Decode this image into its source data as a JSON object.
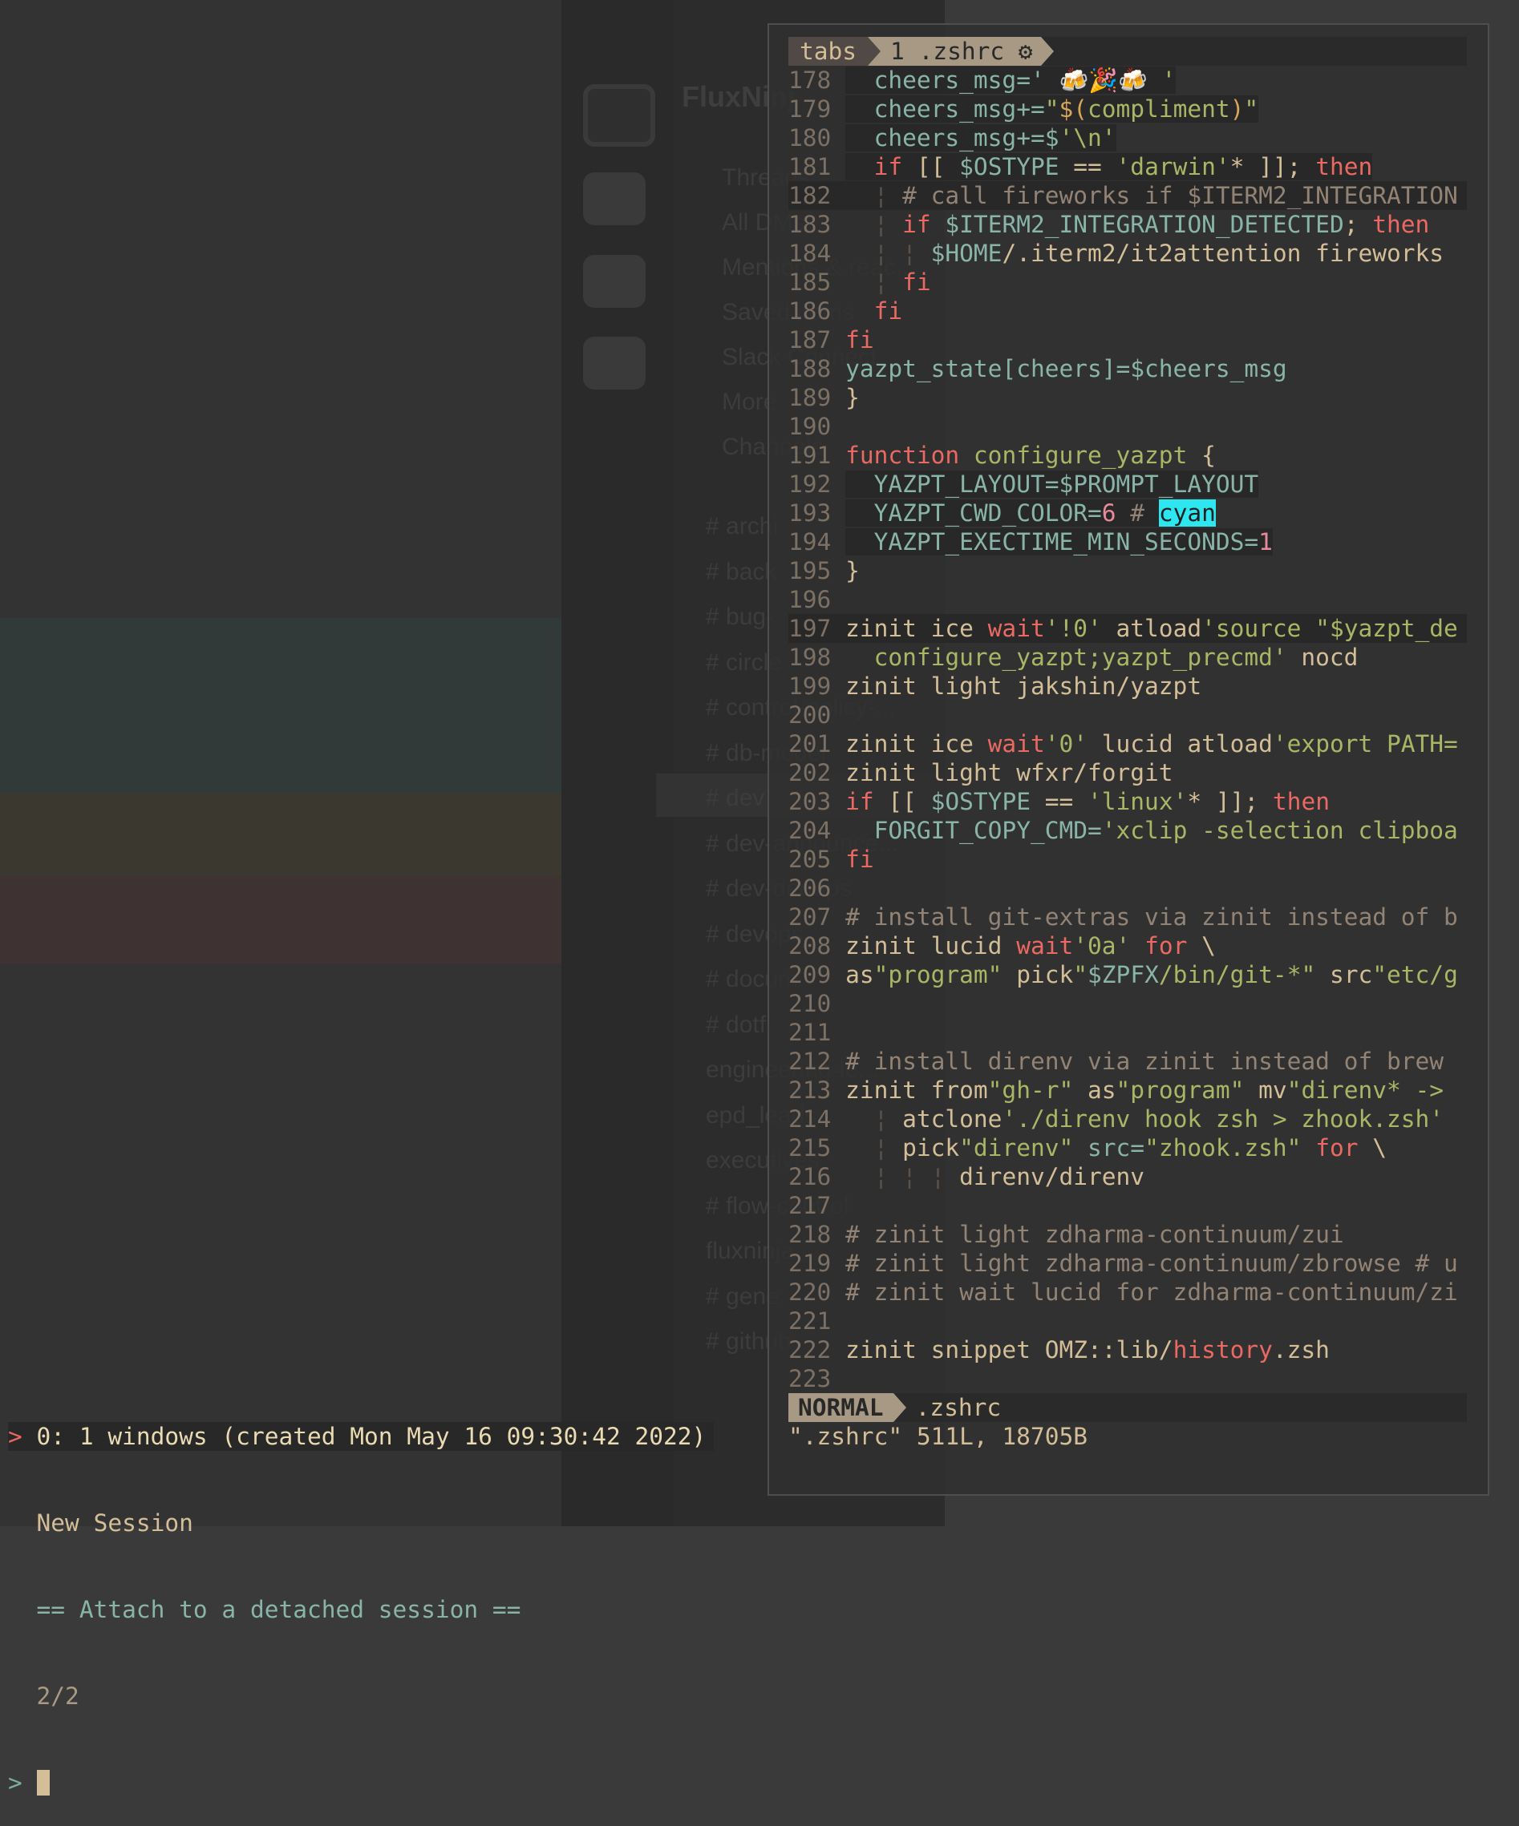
{
  "background": {
    "slack": {
      "workspace": "FluxNinj",
      "nav": [
        "Threads",
        "All DMs",
        "Mentions & reac...",
        "Saved items",
        "Slack Connect",
        "More",
        "Channels"
      ],
      "channels": [
        "# archi",
        "# back",
        "# bug-",
        "# circle",
        "# control-policy-...",
        "# db-model",
        "# dev",
        "# dev-announce...",
        "# dev-dedups",
        "# devops",
        "# docum",
        "# dotfi",
        "engineering-le...",
        "epd_leads",
        "executives",
        "# flow-control",
        "fluxninja",
        "# gene",
        "# github"
      ]
    }
  },
  "editor": {
    "tabline": {
      "tabs_label": "tabs",
      "active_tab": "1 .zshrc ⚙"
    },
    "lines": [
      {
        "n": "178",
        "hl": true,
        "seg": [
          [
            "  cheers_msg='",
            "v"
          ],
          [
            " 🍻🎉🍻 ",
            "t"
          ],
          [
            "'",
            "s"
          ]
        ]
      },
      {
        "n": "179",
        "hl": true,
        "seg": [
          [
            "  cheers_msg+=",
            "v"
          ],
          [
            "\"",
            "s"
          ],
          [
            "$(",
            "o"
          ],
          [
            "compliment",
            "s"
          ],
          [
            ")",
            "o"
          ],
          [
            "\"",
            "s"
          ]
        ]
      },
      {
        "n": "180",
        "hl": true,
        "seg": [
          [
            "  cheers_msg+=$",
            "v"
          ],
          [
            "'\\n'",
            "s"
          ]
        ]
      },
      {
        "n": "181",
        "hl": true,
        "seg": [
          [
            "  ",
            "t"
          ],
          [
            "if",
            "k"
          ],
          [
            " [[ ",
            "t"
          ],
          [
            "$OSTYPE",
            "v"
          ],
          [
            " == ",
            "t"
          ],
          [
            "'darwin'",
            "s"
          ],
          [
            "* ]]; ",
            "t"
          ],
          [
            "then",
            "k"
          ]
        ]
      },
      {
        "n": "182",
        "hl": true,
        "seg": [
          [
            "  ¦ ",
            "g"
          ],
          [
            "# call fireworks if $ITERM2_INTEGRATION",
            "c"
          ]
        ]
      },
      {
        "n": "183",
        "seg": [
          [
            "  ¦ ",
            "g"
          ],
          [
            "if",
            "k"
          ],
          [
            " ",
            "t"
          ],
          [
            "$ITERM2_INTEGRATION_DETECTED",
            "v"
          ],
          [
            "; ",
            "t"
          ],
          [
            "then",
            "k"
          ]
        ]
      },
      {
        "n": "184",
        "seg": [
          [
            "  ¦ ¦ ",
            "g"
          ],
          [
            "$HOME",
            "v"
          ],
          [
            "/.iterm2/it2attention fireworks",
            "t"
          ]
        ]
      },
      {
        "n": "185",
        "seg": [
          [
            "  ¦ ",
            "g"
          ],
          [
            "fi",
            "k"
          ]
        ]
      },
      {
        "n": "186",
        "seg": [
          [
            "  ",
            "t"
          ],
          [
            "fi",
            "k"
          ]
        ]
      },
      {
        "n": "187",
        "seg": [
          [
            "fi",
            "k"
          ]
        ]
      },
      {
        "n": "188",
        "seg": [
          [
            "yazpt_state[cheers]=$cheers_msg",
            "v"
          ]
        ]
      },
      {
        "n": "189",
        "seg": [
          [
            "}",
            "t"
          ]
        ]
      },
      {
        "n": "190",
        "seg": []
      },
      {
        "n": "191",
        "seg": [
          [
            "function",
            "k"
          ],
          [
            " ",
            "t"
          ],
          [
            "configure_yazpt",
            "s"
          ],
          [
            " {",
            "t"
          ]
        ]
      },
      {
        "n": "192",
        "hl": true,
        "seg": [
          [
            "  YAZPT_LAYOUT=$PROMPT_LAYOUT",
            "v"
          ]
        ]
      },
      {
        "n": "193",
        "hl": true,
        "seg": [
          [
            "  YAZPT_CWD_COLOR=",
            "v"
          ],
          [
            "6",
            "n"
          ],
          [
            " # ",
            "c"
          ],
          [
            "cyan",
            "cy"
          ]
        ]
      },
      {
        "n": "194",
        "hl": true,
        "seg": [
          [
            "  YAZPT_EXECTIME_MIN_SECONDS=",
            "v"
          ],
          [
            "1",
            "n"
          ]
        ]
      },
      {
        "n": "195",
        "seg": [
          [
            "}",
            "t"
          ]
        ]
      },
      {
        "n": "196",
        "seg": []
      },
      {
        "n": "197",
        "hl": true,
        "seg": [
          [
            "zinit ice ",
            "t"
          ],
          [
            "wait",
            "k"
          ],
          [
            "'!0'",
            "s"
          ],
          [
            " atload",
            "t"
          ],
          [
            "'source \"$yazpt_de",
            "s"
          ]
        ]
      },
      {
        "n": "198",
        "seg": [
          [
            "  configure_yazpt;yazpt_precmd'",
            "s"
          ],
          [
            " nocd",
            "t"
          ]
        ]
      },
      {
        "n": "199",
        "seg": [
          [
            "zinit light jakshin/yazpt",
            "t"
          ]
        ]
      },
      {
        "n": "200",
        "seg": []
      },
      {
        "n": "201",
        "seg": [
          [
            "zinit ice ",
            "t"
          ],
          [
            "wait",
            "k"
          ],
          [
            "'0'",
            "s"
          ],
          [
            " lucid atload",
            "t"
          ],
          [
            "'export PATH=",
            "s"
          ]
        ]
      },
      {
        "n": "202",
        "seg": [
          [
            "zinit light wfxr/forgit",
            "t"
          ]
        ]
      },
      {
        "n": "203",
        "seg": [
          [
            "if",
            "k"
          ],
          [
            " [[ ",
            "t"
          ],
          [
            "$OSTYPE",
            "v"
          ],
          [
            " == ",
            "t"
          ],
          [
            "'linux'",
            "s"
          ],
          [
            "* ]]; ",
            "t"
          ],
          [
            "then",
            "k"
          ]
        ]
      },
      {
        "n": "204",
        "seg": [
          [
            "  FORGIT_COPY_CMD=",
            "v"
          ],
          [
            "'xclip -selection clipboa",
            "s"
          ]
        ]
      },
      {
        "n": "205",
        "seg": [
          [
            "fi",
            "k"
          ]
        ]
      },
      {
        "n": "206",
        "seg": []
      },
      {
        "n": "207",
        "seg": [
          [
            "# install git-extras via zinit instead of b",
            "c"
          ]
        ]
      },
      {
        "n": "208",
        "seg": [
          [
            "zinit lucid ",
            "t"
          ],
          [
            "wait",
            "k"
          ],
          [
            "'0a'",
            "s"
          ],
          [
            " ",
            "t"
          ],
          [
            "for",
            "k"
          ],
          [
            " \\",
            "t"
          ]
        ]
      },
      {
        "n": "209",
        "seg": [
          [
            "as",
            "t"
          ],
          [
            "\"program\"",
            "s"
          ],
          [
            " pick",
            "t"
          ],
          [
            "\"",
            "s"
          ],
          [
            "$ZPFX",
            "v"
          ],
          [
            "/bin/git-*",
            "s"
          ],
          [
            "\"",
            "s"
          ],
          [
            " src",
            "t"
          ],
          [
            "\"etc/g",
            "s"
          ]
        ]
      },
      {
        "n": "210",
        "seg": []
      },
      {
        "n": "211",
        "seg": []
      },
      {
        "n": "212",
        "seg": [
          [
            "# install direnv via zinit instead of brew",
            "c"
          ]
        ]
      },
      {
        "n": "213",
        "seg": [
          [
            "zinit from",
            "t"
          ],
          [
            "\"gh-r\"",
            "s"
          ],
          [
            " as",
            "t"
          ],
          [
            "\"program\"",
            "s"
          ],
          [
            " mv",
            "t"
          ],
          [
            "\"direnv* ->",
            "s"
          ]
        ]
      },
      {
        "n": "214",
        "seg": [
          [
            "  ¦ ",
            "g"
          ],
          [
            "atclone",
            "t"
          ],
          [
            "'./direnv hook zsh > zhook.zsh'",
            "s"
          ]
        ]
      },
      {
        "n": "215",
        "seg": [
          [
            "  ¦ ",
            "g"
          ],
          [
            "pick",
            "t"
          ],
          [
            "\"direnv\"",
            "s"
          ],
          [
            " ",
            "t"
          ],
          [
            "src=",
            "v"
          ],
          [
            "\"zhook.zsh\"",
            "s"
          ],
          [
            " ",
            "t"
          ],
          [
            "for",
            "k"
          ],
          [
            " \\",
            "t"
          ]
        ]
      },
      {
        "n": "216",
        "seg": [
          [
            "  ¦ ¦ ¦ ",
            "g"
          ],
          [
            "direnv/direnv",
            "t"
          ]
        ]
      },
      {
        "n": "217",
        "seg": []
      },
      {
        "n": "218",
        "seg": [
          [
            "# zinit light zdharma-continuum/zui",
            "c"
          ]
        ]
      },
      {
        "n": "219",
        "seg": [
          [
            "# zinit light zdharma-continuum/zbrowse # u",
            "c"
          ]
        ]
      },
      {
        "n": "220",
        "seg": [
          [
            "# zinit wait lucid for zdharma-continuum/zi",
            "c"
          ]
        ]
      },
      {
        "n": "221",
        "seg": []
      },
      {
        "n": "222",
        "seg": [
          [
            "zinit snippet OMZ::lib/",
            "t"
          ],
          [
            "history",
            "k"
          ],
          [
            ".zsh",
            "t"
          ]
        ]
      },
      {
        "n": "223",
        "seg": []
      }
    ],
    "statusline": {
      "mode": "NORMAL",
      "filename": ".zshrc"
    },
    "message": "\".zshrc\" 511L, 18705B"
  },
  "tmux_chooser": {
    "selected_marker": ">",
    "session_row": "0: 1 windows (created Mon May 16 09:30:42 2022)",
    "new_session": "New Session",
    "attach": "== Attach to a detached session ==",
    "count": "2/2",
    "prompt": ">"
  },
  "colors": {
    "keyword": "#ea6962",
    "identifier": "#89b4a8",
    "string": "#a9b665",
    "comment": "#928374",
    "highlight_cyan": "#2ee6f0"
  }
}
